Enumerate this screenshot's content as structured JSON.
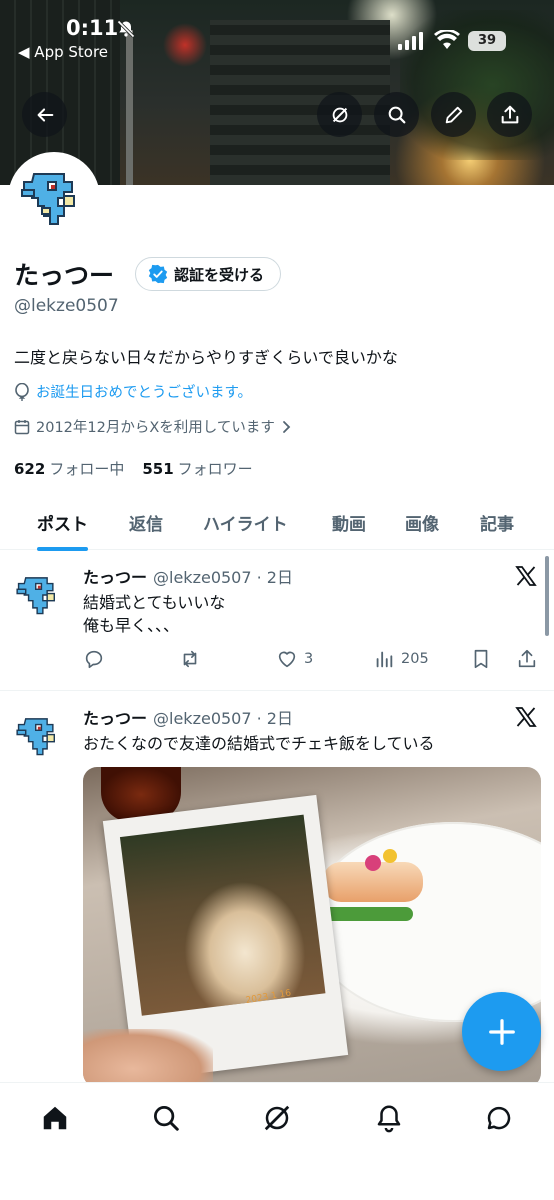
{
  "status_bar": {
    "time": "0:11",
    "back_app": "◀ App Store",
    "battery": "39"
  },
  "profile": {
    "name": "たっつー",
    "verify_label": "認証を受ける",
    "handle": "@lekze0507",
    "bio": "二度と戻らない日々だからやりすぎくらいで良いかな",
    "birthday_text": "お誕生日おめでとうございます。",
    "joined_text": "2012年12月からXを利用しています",
    "following_count": "622",
    "following_label": "フォロー中",
    "followers_count": "551",
    "followers_label": "フォロワー"
  },
  "tabs": [
    {
      "label": "ポスト",
      "active": true
    },
    {
      "label": "返信"
    },
    {
      "label": "ハイライト"
    },
    {
      "label": "動画"
    },
    {
      "label": "画像"
    },
    {
      "label": "記事"
    }
  ],
  "posts": [
    {
      "name": "たっつー",
      "meta": "@lekze0507 · 2日",
      "text_line1": "結婚式とてもいいな",
      "text_line2": "俺も早く、、、",
      "likes": "3",
      "views": "205"
    },
    {
      "name": "たっつー",
      "meta": "@lekze0507 · 2日",
      "text_line1": "おたくなので友達の結婚式でチェキ飯をしている",
      "photo_date": "2023  1 16"
    }
  ],
  "icons": {
    "back": "arrow-left-icon",
    "grok": "grok-icon",
    "search": "search-icon",
    "edit": "pencil-icon",
    "share": "share-icon",
    "home": "home-icon",
    "notifications": "bell-icon",
    "messages": "messages-icon",
    "compose": "plus-icon"
  },
  "colors": {
    "accent": "#1d9bf0",
    "text": "#0f1419",
    "muted": "#536471"
  }
}
